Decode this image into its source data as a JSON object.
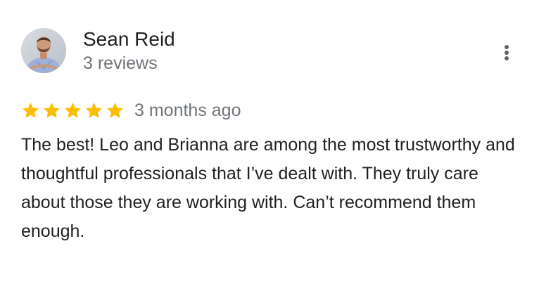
{
  "review": {
    "reviewer": {
      "name": "Sean Reid",
      "review_count": "3 reviews",
      "avatar_icon": "person-photo-avatar"
    },
    "rating": {
      "stars": 5,
      "max": 5,
      "star_color": "#FBBC04",
      "icon": "star-icon"
    },
    "time": "3 months ago",
    "text": "The best! Leo and Brianna are among the most trustworthy and thoughtful professionals that I’ve dealt with. They truly care about those they are working with. Can’t recommend them enough.",
    "menu_icon": "more-vert-icon"
  },
  "colors": {
    "text_primary": "#202124",
    "text_secondary": "#70757a",
    "icon": "#5f6368"
  }
}
